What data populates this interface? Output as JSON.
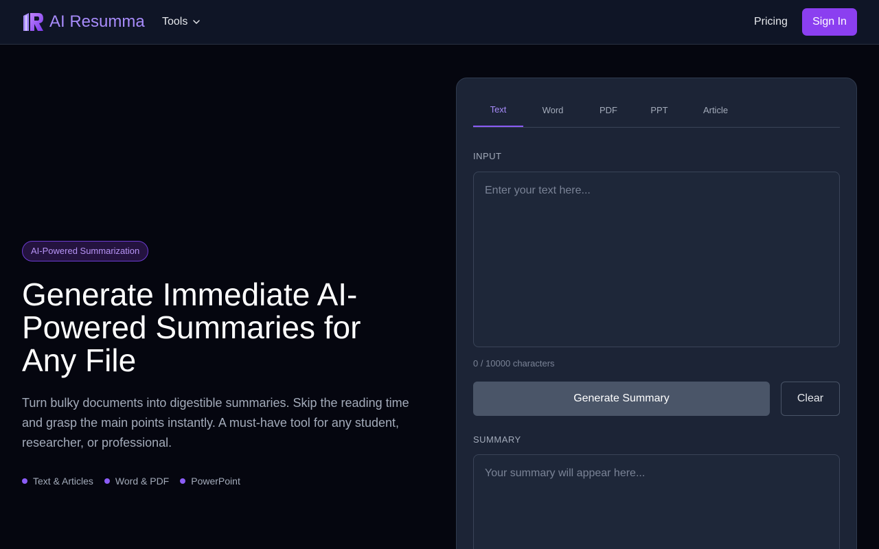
{
  "header": {
    "brand": "AI Resumma",
    "tools_label": "Tools",
    "pricing_label": "Pricing",
    "signin_label": "Sign In"
  },
  "hero": {
    "badge": "AI-Powered Summarization",
    "headline": "Generate Immediate AI-Powered Summaries for Any File",
    "description": "Turn bulky documents into digestible summaries. Skip the reading time and grasp the main points instantly. A must-have tool for any student, researcher, or professional.",
    "features": [
      "Text & Articles",
      "Word & PDF",
      "PowerPoint"
    ]
  },
  "panel": {
    "tabs": [
      {
        "label": "Text",
        "active": true
      },
      {
        "label": "Word",
        "active": false
      },
      {
        "label": "PDF",
        "active": false
      },
      {
        "label": "PPT",
        "active": false
      },
      {
        "label": "Article",
        "active": false
      }
    ],
    "input_label": "INPUT",
    "input_placeholder": "Enter your text here...",
    "input_value": "",
    "char_count": "0 / 10000 characters",
    "generate_label": "Generate Summary",
    "clear_label": "Clear",
    "summary_label": "SUMMARY",
    "summary_placeholder": "Your summary will appear here..."
  },
  "colors": {
    "accent": "#8b3ff0",
    "brand_text": "#a78bfa",
    "background": "#05060f",
    "card": "#1c2436"
  }
}
